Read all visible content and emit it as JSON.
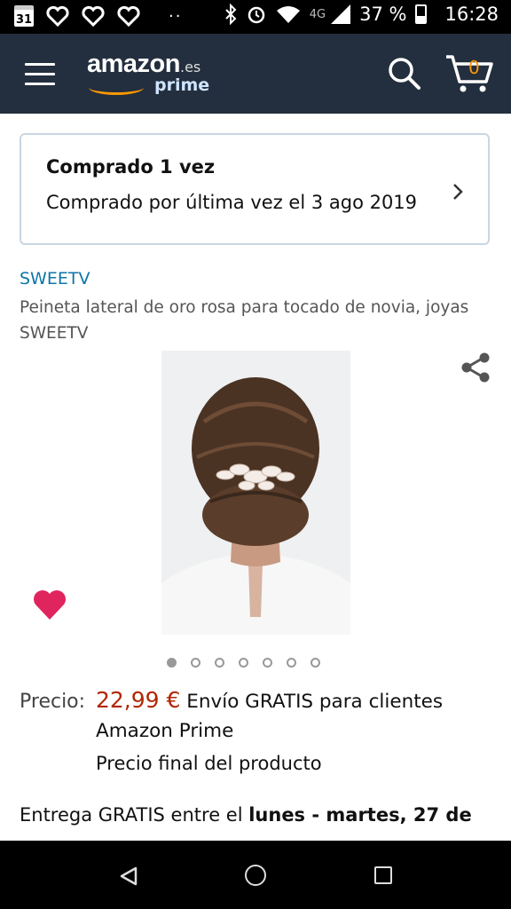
{
  "status_bar": {
    "calendar_day": "31",
    "network": "4G",
    "battery": "37 %",
    "time": "16:28",
    "icons": [
      "calendar-icon",
      "heart-outline-icon",
      "heart-outline-icon",
      "heart-outline-icon",
      "more-dots-icon",
      "bluetooth-icon",
      "alarm-icon",
      "wifi-icon",
      "signal-icon",
      "battery-icon"
    ]
  },
  "header": {
    "logo_text": "amazon",
    "logo_suffix": ".es",
    "logo_prime": "prime",
    "cart_count": "0",
    "brand_color": "#232f3e",
    "accent_color": "#ff9900"
  },
  "purchase_history": {
    "title": "Comprado 1 vez",
    "subtitle": "Comprado por última vez el 3 ago 2019"
  },
  "product": {
    "brand": "SWEETV",
    "title": "Peineta lateral de oro rosa para tocado de novia, joyas SWEETV",
    "image_count": 7,
    "active_image_index": 0
  },
  "pricing": {
    "price_label": "Precio:",
    "price_value": "22,99 €",
    "shipping_text": "Envío GRATIS para clientes Amazon Prime",
    "final_price_note": "Precio final del producto",
    "price_color": "#b12704"
  },
  "delivery": {
    "prefix": "Entrega GRATIS entre el ",
    "dates": "lunes - martes, 27 de"
  },
  "android_nav": {
    "icons": [
      "back-icon",
      "home-icon",
      "recent-apps-icon"
    ]
  }
}
